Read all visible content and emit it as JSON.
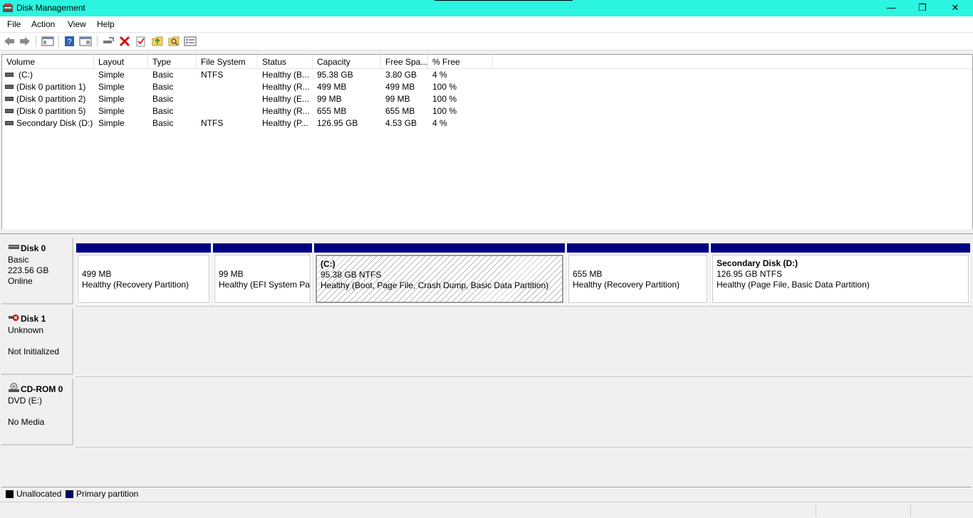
{
  "window": {
    "title": "Disk Management",
    "min_glyph": "—",
    "max_glyph": "❐",
    "close_glyph": "✕"
  },
  "menu": [
    "File",
    "Action",
    "View",
    "Help"
  ],
  "toolbar_icons": [
    "back-arrow-icon",
    "forward-arrow-icon",
    "console-tree-icon",
    "help-icon",
    "properties-icon",
    "connect-disk-icon",
    "delete-icon",
    "check-icon",
    "folder-up-icon",
    "folder-search-icon",
    "list-view-icon"
  ],
  "columns": [
    "Volume",
    "Layout",
    "Type",
    "File System",
    "Status",
    "Capacity",
    "Free Spa...",
    "% Free"
  ],
  "volumes": [
    {
      "volume": "(C:)",
      "layout": "Simple",
      "type": "Basic",
      "fs": "NTFS",
      "status": "Healthy (B...",
      "capacity": "95.38 GB",
      "free": "3.80 GB",
      "pct": "4 %"
    },
    {
      "volume": "(Disk 0 partition 1)",
      "layout": "Simple",
      "type": "Basic",
      "fs": "",
      "status": "Healthy (R...",
      "capacity": "499 MB",
      "free": "499 MB",
      "pct": "100 %"
    },
    {
      "volume": "(Disk 0 partition 2)",
      "layout": "Simple",
      "type": "Basic",
      "fs": "",
      "status": "Healthy (E...",
      "capacity": "99 MB",
      "free": "99 MB",
      "pct": "100 %"
    },
    {
      "volume": "(Disk 0 partition 5)",
      "layout": "Simple",
      "type": "Basic",
      "fs": "",
      "status": "Healthy (R...",
      "capacity": "655 MB",
      "free": "655 MB",
      "pct": "100 %"
    },
    {
      "volume": "Secondary Disk (D:)",
      "layout": "Simple",
      "type": "Basic",
      "fs": "NTFS",
      "status": "Healthy (P...",
      "capacity": "126.95 GB",
      "free": "4.53 GB",
      "pct": "4 %"
    }
  ],
  "disks": [
    {
      "name": "Disk 0",
      "line1": "Basic",
      "line2": "223.56 GB",
      "line3": "Online",
      "partitions": [
        {
          "label": "",
          "size": "499 MB",
          "status": "Healthy (Recovery Partition)"
        },
        {
          "label": "",
          "size": "99 MB",
          "status": "Healthy (EFI System Partition)"
        },
        {
          "label": "(C:)",
          "size": "95.38 GB NTFS",
          "status": "Healthy (Boot, Page File, Crash Dump, Basic Data Partition)"
        },
        {
          "label": "",
          "size": "655 MB",
          "status": "Healthy (Recovery Partition)"
        },
        {
          "label": "Secondary Disk  (D:)",
          "size": "126.95 GB NTFS",
          "status": "Healthy (Page File, Basic Data Partition)"
        }
      ]
    },
    {
      "name": "Disk 1",
      "line1": "Unknown",
      "line2": "",
      "line3": "Not Initialized"
    },
    {
      "name": "CD-ROM 0",
      "line1": "DVD (E:)",
      "line2": "",
      "line3": "No Media"
    }
  ],
  "legend": [
    {
      "label": "Unallocated",
      "color": "#000000"
    },
    {
      "label": "Primary partition",
      "color": "#000080"
    }
  ],
  "colors": {
    "titlebar": "#2bf5e0",
    "primary": "#000080"
  }
}
